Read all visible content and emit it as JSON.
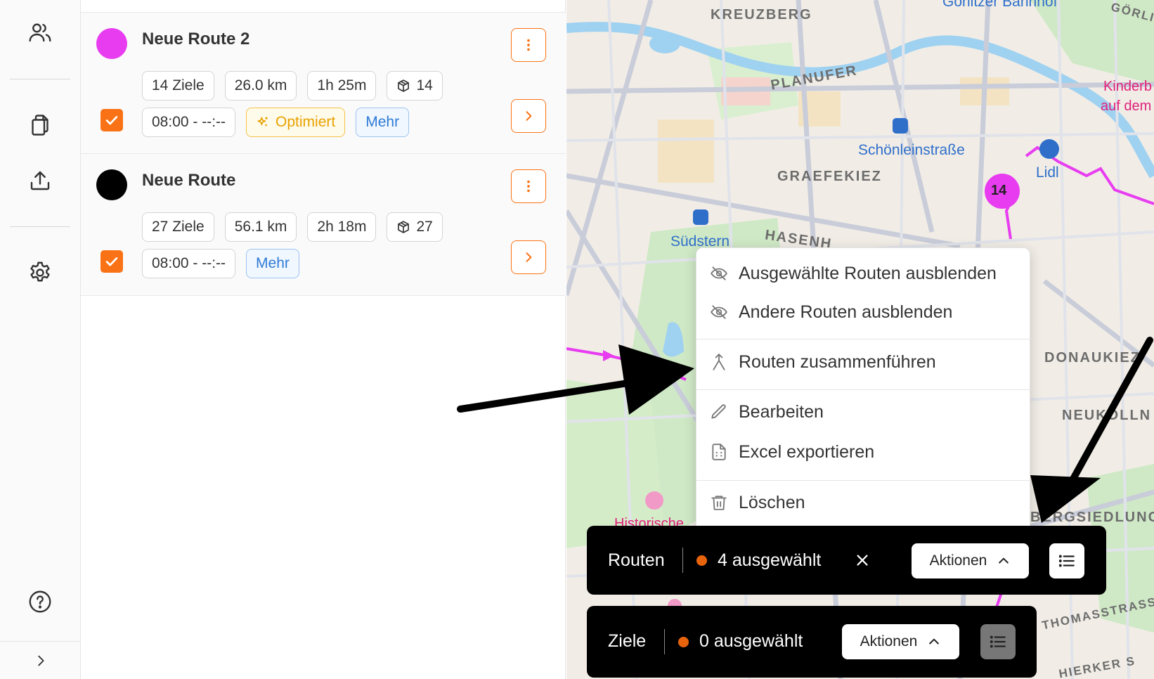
{
  "rail": {
    "icons": [
      "users-icon",
      "copy-icon",
      "upload-icon",
      "settings-icon",
      "help-icon",
      "chevron-right-icon"
    ]
  },
  "routes": [
    {
      "name": "Neue Route 2",
      "color": "#e83cf0",
      "stops": "14 Ziele",
      "distance": "26.0 km",
      "duration": "1h 25m",
      "packages": "14",
      "time_window": "08:00 - --:--",
      "optimized_label": "Optimiert",
      "more_label": "Mehr",
      "checked": true
    },
    {
      "name": "Neue Route",
      "color": "#000000",
      "stops": "27 Ziele",
      "distance": "56.1 km",
      "duration": "2h 18m",
      "packages": "27",
      "time_window": "08:00 - --:--",
      "more_label": "Mehr",
      "checked": true
    }
  ],
  "map": {
    "labels": {
      "kreuzberg": "KREUZBERG",
      "planufer": "PLANUFER",
      "graefekiez": "GRAEFEKIEZ",
      "schoenlein": "Schönleinstraße",
      "suedstern": "Südstern",
      "hasen": "HASENH",
      "donaukiez": "DONAUKIEZ",
      "neukoelln": "NEUKÖLLN",
      "siedlung": "BERGSIEDLUNG",
      "thomas": "THOMASSTRASSE",
      "goerlitzer": "Görlitzer Bahnhof",
      "goerli": "GÖRLI",
      "lidl": "Lidl",
      "kinder": "Kinderb",
      "aufdem": "auf dem",
      "historische": "Historische",
      "schierker": "HIERKER S"
    },
    "cluster_count": "14"
  },
  "context_menu": {
    "items": [
      {
        "label": "Ausgewählte Routen ausblenden",
        "icon": "eye-off-icon"
      },
      {
        "label": "Andere Routen ausblenden",
        "icon": "eye-off-icon"
      },
      {
        "label": "Routen zusammenführen",
        "icon": "merge-icon"
      },
      {
        "label": "Bearbeiten",
        "icon": "pencil-icon"
      },
      {
        "label": "Excel exportieren",
        "icon": "file-spreadsheet-icon"
      },
      {
        "label": "Löschen",
        "icon": "trash-icon"
      }
    ]
  },
  "routes_bar": {
    "title": "Routen",
    "selected": "4 ausgewählt",
    "actions_label": "Aktionen"
  },
  "stops_bar": {
    "title": "Ziele",
    "selected": "0 ausgewählt",
    "actions_label": "Aktionen"
  },
  "colors": {
    "accent": "#f97316",
    "selection_dot": "#e8640c",
    "route_magenta": "#e83cf0"
  }
}
